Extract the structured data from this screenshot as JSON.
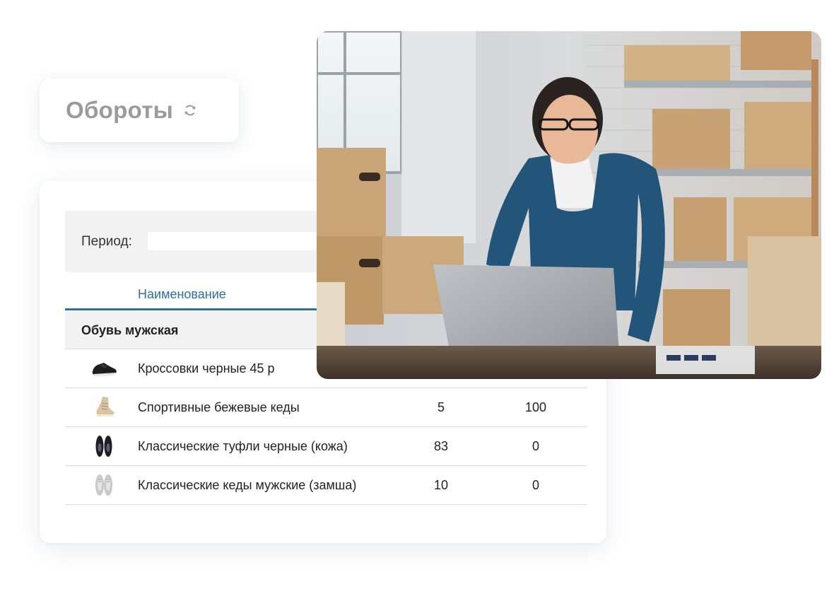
{
  "header": {
    "title": "Обороты",
    "refresh_icon": "refresh-icon"
  },
  "filter": {
    "period_label": "Период:",
    "period_value": ""
  },
  "table": {
    "columns": {
      "name": "Наименование"
    },
    "group": "Обувь мужская",
    "rows": [
      {
        "icon": "black-sneaker-icon",
        "name": "Кроссовки черные 45 р",
        "q1": "",
        "q2": ""
      },
      {
        "icon": "beige-sneaker-icon",
        "name": "Спортивные бежевые кеды",
        "q1": "5",
        "q2": "100"
      },
      {
        "icon": "black-shoes-icon",
        "name": "Классические туфли черные (кожа)",
        "q1": "83",
        "q2": "0"
      },
      {
        "icon": "grey-sneakers-icon",
        "name": "Классические кеды мужские (замша)",
        "q1": "10",
        "q2": "0"
      }
    ]
  },
  "photo": {
    "subject": "woman-at-laptop-photo"
  },
  "colors": {
    "accent": "#2f6ea1",
    "title_grey": "#9b9b9b",
    "panel_bg": "#f2f2f2"
  }
}
